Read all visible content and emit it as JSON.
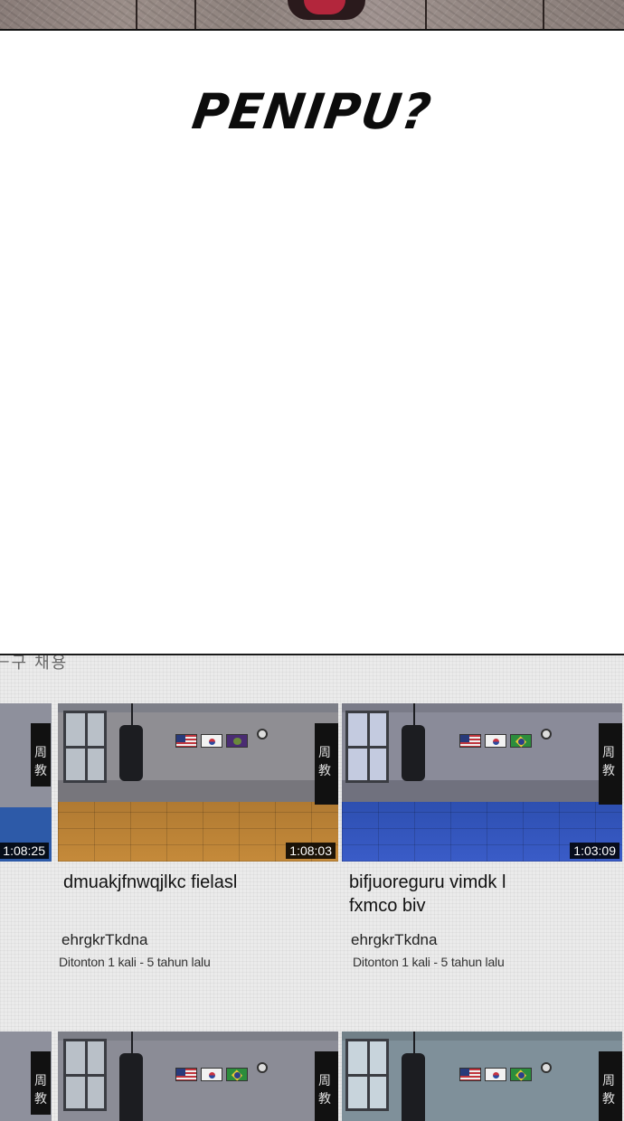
{
  "caption": "PENIPU?",
  "header_fragment": "ㅡ구 채용",
  "colors": {
    "panel_bg": "#ebebeb",
    "duration_bg": "#000000",
    "floor_orange": "#b07a32",
    "floor_blue": "#2d4fb0"
  },
  "videos": [
    {
      "duration": "1:08:25",
      "title": "",
      "channel": "",
      "meta": ""
    },
    {
      "duration": "1:08:03",
      "title": "dmuakjfnwqjlkc fielasl",
      "channel": "ehrgkrTkdna",
      "meta": "Ditonton 1 kali - 5 tahun lalu"
    },
    {
      "duration": "1:03:09",
      "title_line1": "bifjuoreguru vimdk l",
      "title_line2": "fxmco biv",
      "channel": "ehrgkrTkdna",
      "meta": "Ditonton 1 kali - 5 tahun lalu"
    }
  ],
  "banner_text": "周 教"
}
